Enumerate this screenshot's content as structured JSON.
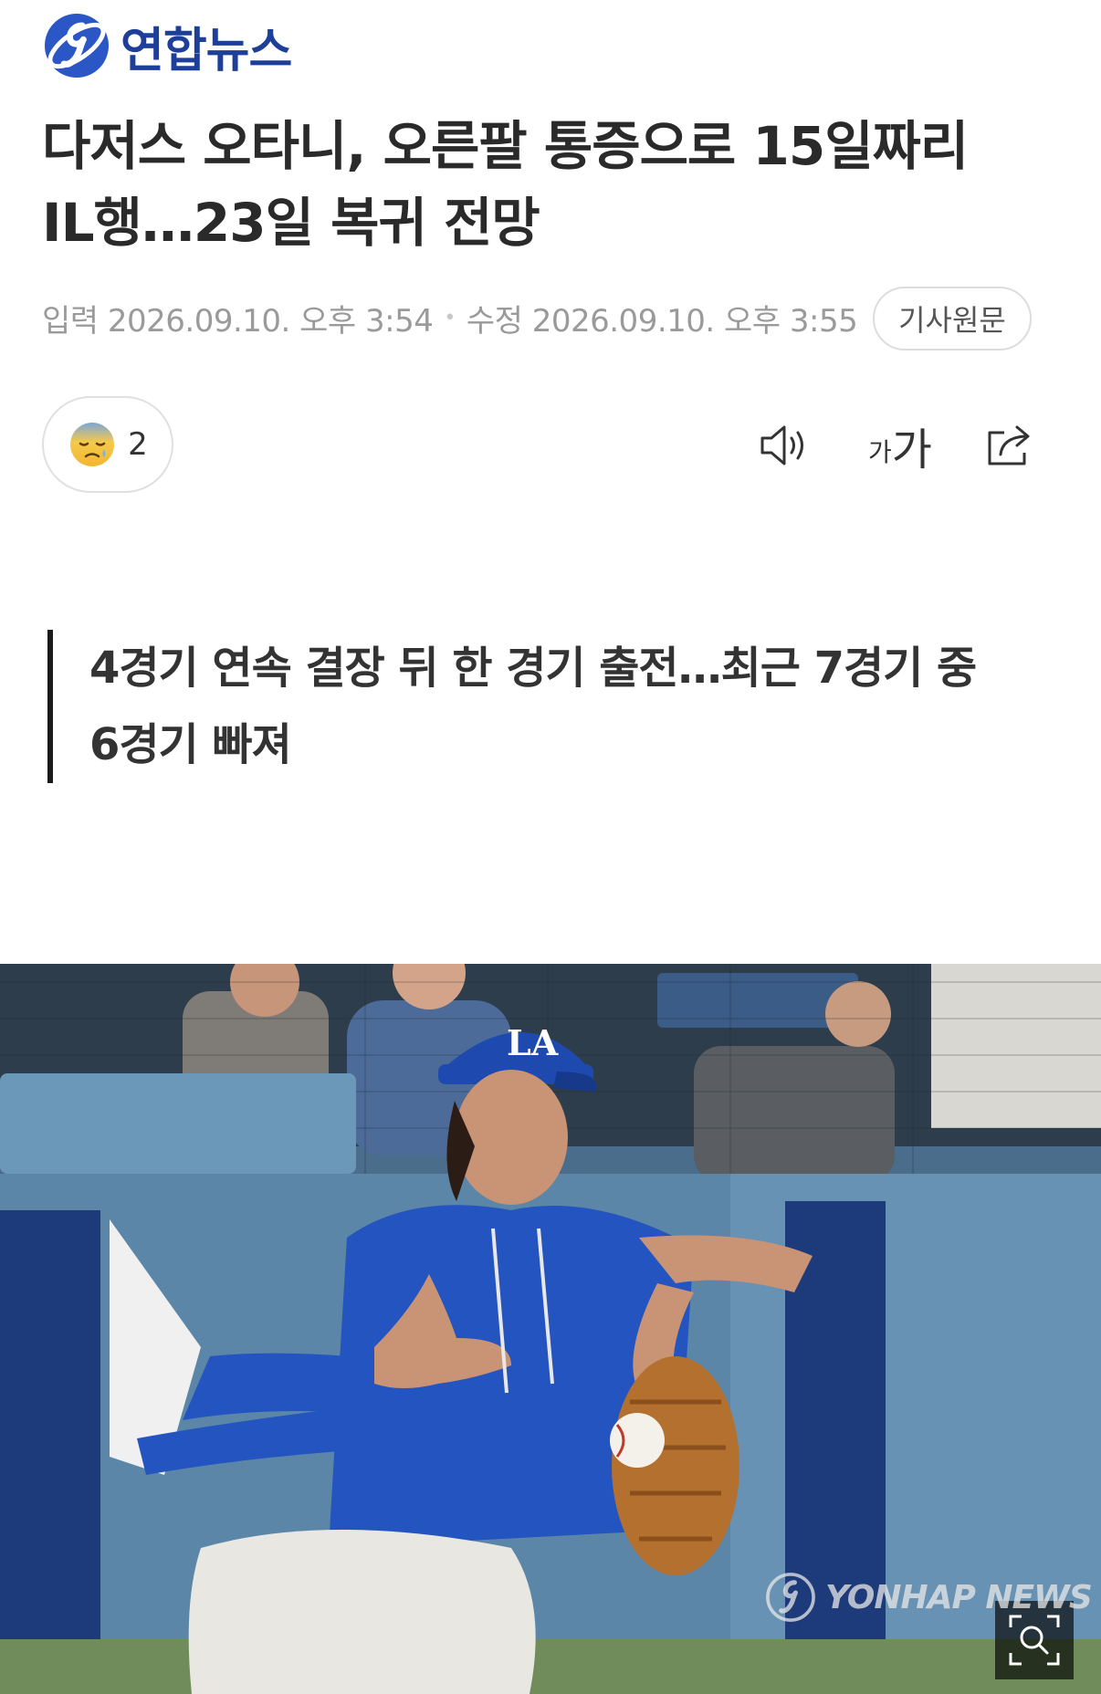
{
  "brand": {
    "logo_text": "연합뉴스",
    "logo_icon": "yonhap-logo-icon",
    "accent_color": "#1d3f9a"
  },
  "article": {
    "headline_line1": "다저스 오타니, 오른팔 통증으로 15일짜리",
    "headline_line2": "IL행…23일 복귀 전망",
    "input_time": "입력 2026.09.10. 오후 3:54",
    "edit_time": "수정 2026.09.10. 오후 3:55",
    "origin_label": "기사원문",
    "summary_line1": "4경기 연속 결장 뒤 한 경기 출전…최근 7경기 중",
    "summary_line2": "6경기 빠져"
  },
  "toolbar": {
    "reaction_icon": "sad-sweat-emoji-icon",
    "reaction_count": "2",
    "speaker_icon": "speaker-icon",
    "font_small": "가",
    "font_large": "가",
    "share_icon": "share-icon"
  },
  "photo": {
    "zoom_icon": "zoom-search-icon",
    "watermark_text": "YONHAP NEWS"
  }
}
